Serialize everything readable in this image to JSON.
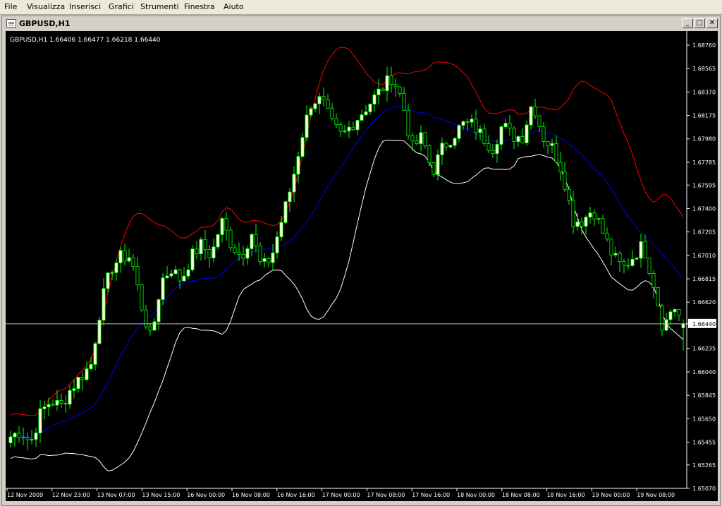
{
  "menu": {
    "items": [
      {
        "label": "File"
      },
      {
        "label": "Visualizza"
      },
      {
        "label": "Inserisci"
      },
      {
        "label": "Grafici"
      },
      {
        "label": "Strumenti"
      },
      {
        "label": "Finestra"
      },
      {
        "label": "Aiuto"
      }
    ]
  },
  "window": {
    "title": "GBPUSD,H1",
    "buttons": {
      "minimize": "_",
      "maximize": "□",
      "close": "✕"
    }
  },
  "chart": {
    "header": "GBPUSD,H1  1.66406 1.66477 1.66218 1.66440",
    "current_price_label": "1.66440",
    "colors": {
      "background": "#000000",
      "bull_candle": "#ffffe0",
      "wick": "#00ff00",
      "upper_band": "#ff0000",
      "middle_band": "#0000ff",
      "lower_band": "#ffffff",
      "axis": "#ffffff"
    }
  },
  "chart_data": {
    "type": "candlestick",
    "symbol": "GBPUSD",
    "timeframe": "H1",
    "last_bar": {
      "open": 1.66406,
      "high": 1.66477,
      "low": 1.66218,
      "close": 1.6644
    },
    "y_ticks": [
      1.6876,
      1.68565,
      1.6837,
      1.68175,
      1.6798,
      1.67785,
      1.67595,
      1.674,
      1.67205,
      1.6701,
      1.66815,
      1.6662,
      1.6644,
      1.66235,
      1.6604,
      1.65845,
      1.6565,
      1.65455,
      1.65265,
      1.6507
    ],
    "y_tick_labels": [
      "1.68760",
      "1.68565",
      "1.68370",
      "1.68175",
      "1.67980",
      "1.67785",
      "1.67595",
      "1.67400",
      "1.67205",
      "1.67010",
      "1.66815",
      "1.66620",
      "1.66440",
      "1.66235",
      "1.66040",
      "1.65845",
      "1.65650",
      "1.65455",
      "1.65265",
      "1.65070"
    ],
    "ylim": [
      1.6507,
      1.6876
    ],
    "x_labels": [
      "12 Nov 2009",
      "12 Nov 23:00",
      "13 Nov 07:00",
      "13 Nov 15:00",
      "16 Nov 00:00",
      "16 Nov 08:00",
      "16 Nov 16:00",
      "17 Nov 00:00",
      "17 Nov 08:00",
      "17 Nov 16:00",
      "18 Nov 00:00",
      "18 Nov 08:00",
      "18 Nov 16:00",
      "19 Nov 00:00",
      "19 Nov 08:00"
    ],
    "close_path": [
      1.655,
      1.6555,
      1.6545,
      1.657,
      1.658,
      1.6575,
      1.659,
      1.66,
      1.661,
      1.666,
      1.669,
      1.67,
      1.67,
      1.666,
      1.663,
      1.668,
      1.669,
      1.668,
      1.67,
      1.671,
      1.67,
      1.673,
      1.671,
      1.67,
      1.672,
      1.669,
      1.67,
      1.673,
      1.676,
      1.68,
      1.683,
      1.683,
      1.681,
      1.68,
      1.681,
      1.682,
      1.683,
      1.684,
      1.685,
      1.683,
      1.679,
      1.68,
      1.677,
      1.679,
      1.68,
      1.681,
      1.681,
      1.68,
      1.679,
      1.681,
      1.68,
      1.68,
      1.683,
      1.68,
      1.679,
      1.677,
      1.673,
      1.673,
      1.674,
      1.672,
      1.67,
      1.669,
      1.67,
      1.671,
      1.668,
      1.664,
      1.666,
      1.6644
    ]
  }
}
